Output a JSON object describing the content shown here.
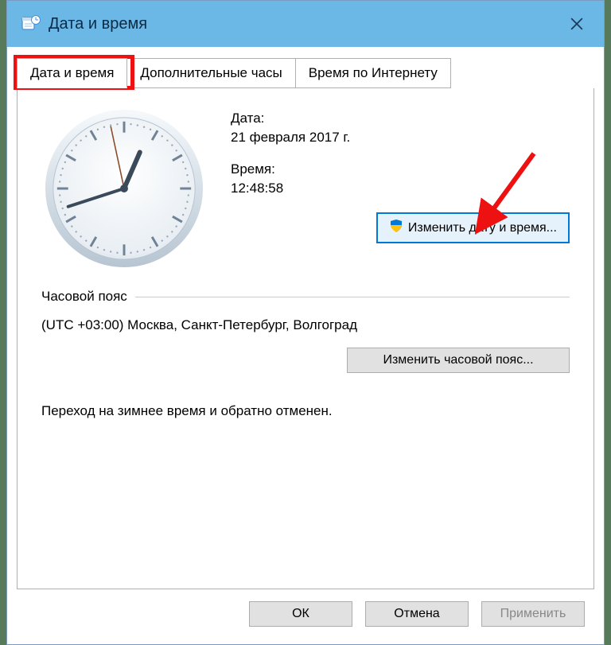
{
  "window": {
    "title": "Дата и время"
  },
  "tabs": {
    "items": [
      {
        "label": "Дата и время"
      },
      {
        "label": "Дополнительные часы"
      },
      {
        "label": "Время по Интернету"
      }
    ]
  },
  "datetime": {
    "date_label": "Дата:",
    "date_value": "21 февраля 2017 г.",
    "time_label": "Время:",
    "time_value": "12:48:58",
    "change_btn": "Изменить дату и время..."
  },
  "timezone": {
    "header": "Часовой пояс",
    "value": "(UTC +03:00) Москва, Санкт-Петербург, Волгоград",
    "change_btn": "Изменить часовой пояс..."
  },
  "dst": {
    "text": "Переход на зимнее время и обратно отменен."
  },
  "footer": {
    "ok": "ОК",
    "cancel": "Отмена",
    "apply": "Применить"
  },
  "clock": {
    "hour": 12,
    "minute": 48,
    "second": 58
  }
}
